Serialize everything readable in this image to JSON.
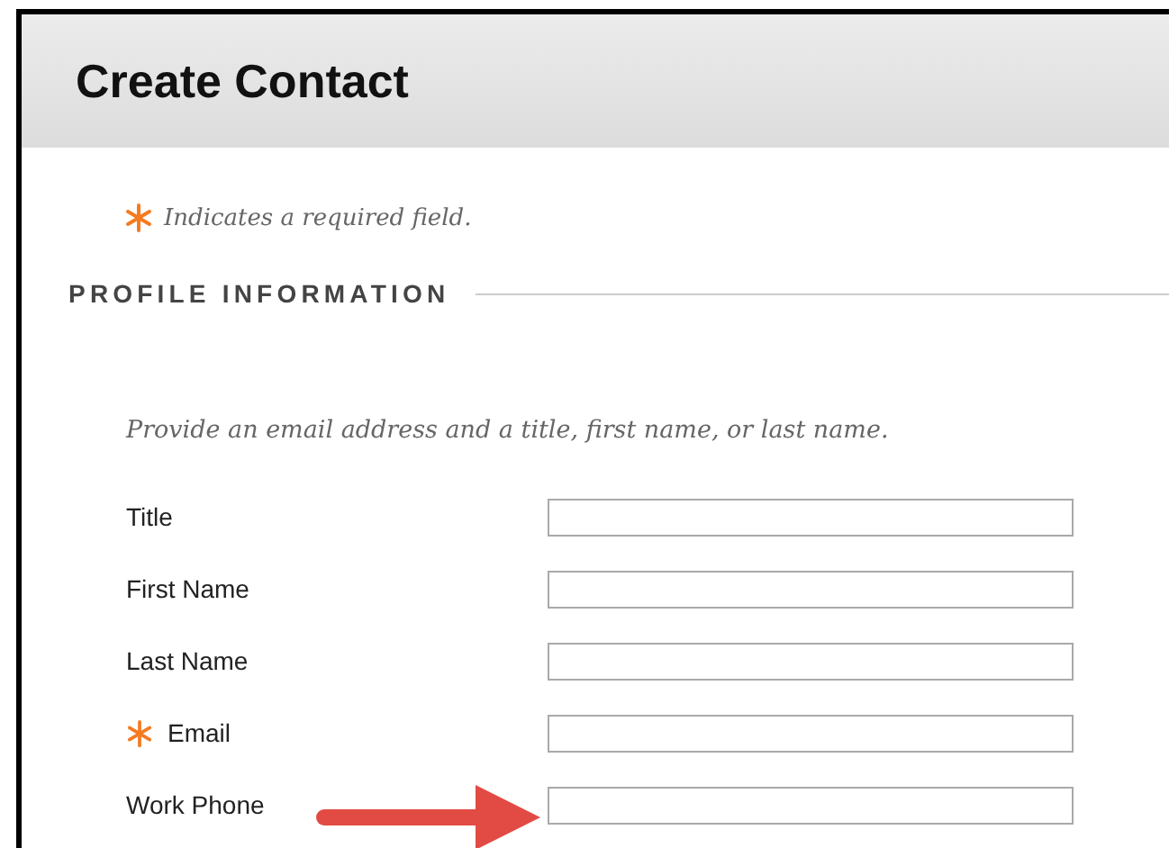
{
  "header": {
    "title": "Create Contact"
  },
  "required_note": {
    "text": "Indicates a required field."
  },
  "section": {
    "heading": "PROFILE INFORMATION",
    "instructions": "Provide an email address and a title, first name, or last name."
  },
  "fields": [
    {
      "label": "Title",
      "required": false,
      "highlighted": false
    },
    {
      "label": "First Name",
      "required": false,
      "highlighted": false
    },
    {
      "label": "Last Name",
      "required": false,
      "highlighted": false
    },
    {
      "label": "Email",
      "required": true,
      "highlighted": false
    },
    {
      "label": "Work Phone",
      "required": false,
      "highlighted": true
    }
  ]
}
